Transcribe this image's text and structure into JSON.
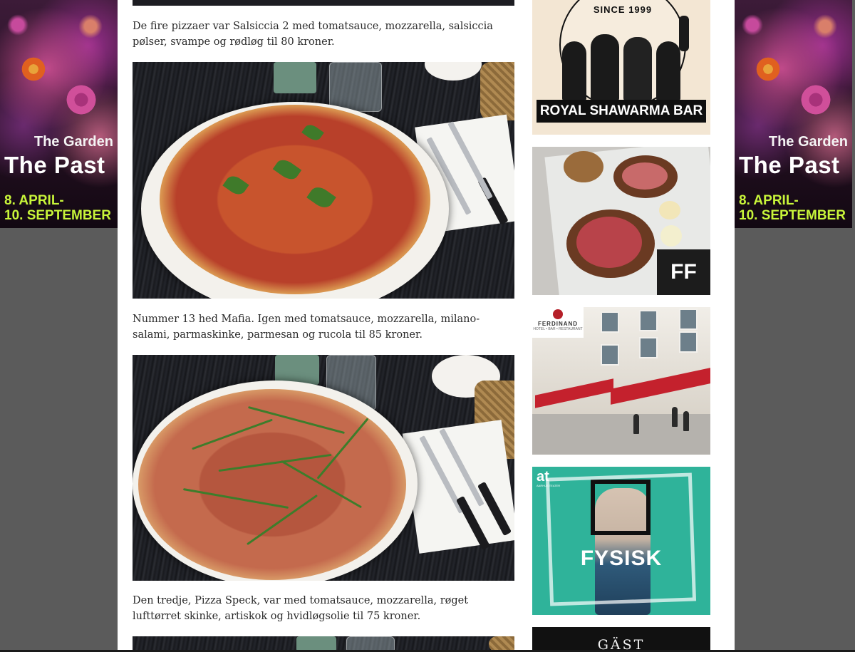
{
  "side_ads": {
    "subtitle": "The Garden",
    "title": "The Past",
    "date_line1": "8. APRIL-",
    "date_line2": "10. SEPTEMBER"
  },
  "article": {
    "paragraphs": [
      "De fire pizzaer var Salsiccia 2 med tomatsauce, mozzarella, salsiccia pølser, svampe og rødløg til 80 kroner.",
      "Nummer 13 hed Mafia. Igen med tomatsauce, mozzarella, milano-salami, parmaskinke, parmesan og rucola til 85 kroner.",
      "Den tredje, Pizza Speck, var med tomatsauce, mozzarella, røget lufttørret skinke, artiskok og hvidløgsolie til 75 kroner."
    ]
  },
  "sidebar": {
    "royal_shawarma": {
      "since": "SINCE 1999",
      "name": "ROYAL SHAWARMA BAR"
    },
    "ff": {
      "label": "FF"
    },
    "ferdinand": {
      "name": "FERDINAND",
      "tagline": "HOTEL • BAR • RESTAURANT"
    },
    "fysisk": {
      "logo": "at",
      "logo_sub": "AARHUS TEATER",
      "title": "FYSISK"
    },
    "gast": {
      "title": "GÄST"
    }
  },
  "colors": {
    "page_bg": "#5b5b5b",
    "content_bg": "#ffffff",
    "ad_accent_green": "#c8f53a",
    "fysisk_teal": "#2fb39a",
    "ferdinand_red": "#c4212d"
  }
}
